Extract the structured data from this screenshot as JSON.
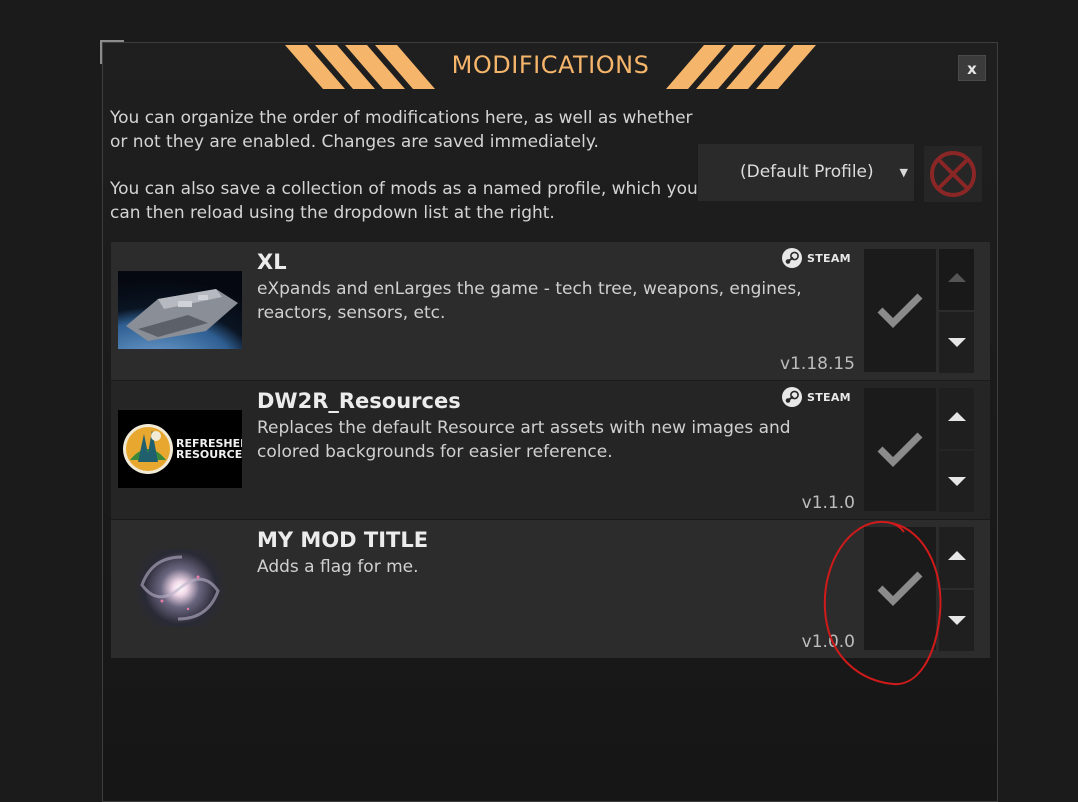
{
  "dialog": {
    "title": "MODIFICATIONS",
    "close_label": "x",
    "description_1": "You can organize the order of modifications here, as well as whether or not they are enabled. Changes are saved immediately.",
    "description_2": "You can also save a collection of mods as a named profile, which you can then reload using the dropdown list at the right.",
    "accent_color": "#f5b56b"
  },
  "profile": {
    "selected": "(Default Profile)",
    "caret": "▼",
    "delete_icon": "circle-x-icon"
  },
  "mods": [
    {
      "title": "XL",
      "description": "eXpands and enLarges the game - tech tree, weapons, engines, reactors, sensors, etc.",
      "version": "v1.18.15",
      "source": "STEAM",
      "enabled": true,
      "move_up_enabled": false,
      "thumbnail": "spaceship-image"
    },
    {
      "title": "DW2R_Resources",
      "description": "Replaces the default Resource art assets with new images and colored backgrounds for easier reference.",
      "version": "v1.1.0",
      "source": "STEAM",
      "enabled": true,
      "move_up_enabled": true,
      "thumbnail": "refreshed-resources-logo",
      "thumbnail_text_1": "REFRESHED",
      "thumbnail_text_2": "RESOURCES"
    },
    {
      "title": "MY MOD TITLE",
      "description": "Adds a flag for me.",
      "version": "v1.0.0",
      "source": "",
      "enabled": true,
      "move_up_enabled": true,
      "thumbnail": "galaxy-image"
    }
  ]
}
